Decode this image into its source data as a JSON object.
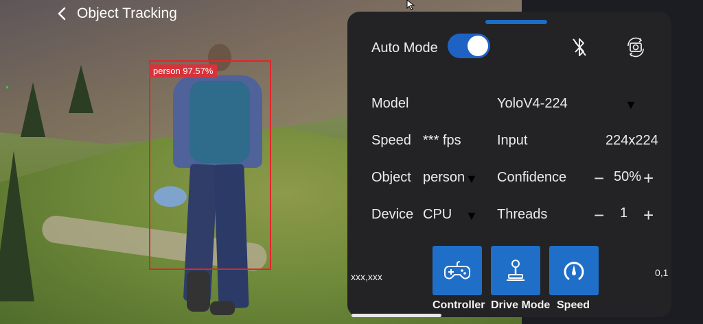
{
  "header": {
    "title": "Object Tracking"
  },
  "detection": {
    "label": "person 97.57%"
  },
  "panel": {
    "auto_mode": {
      "label": "Auto Mode",
      "enabled": true
    },
    "icons": {
      "bluetooth": "bluetooth-off-icon",
      "camera_switch": "camera-switch-icon"
    },
    "model": {
      "label": "Model",
      "value": "YoloV4-224"
    },
    "speed": {
      "label": "Speed",
      "value": "*** fps"
    },
    "input": {
      "label": "Input",
      "value": "224x224"
    },
    "object": {
      "label": "Object",
      "value": "person"
    },
    "confidence": {
      "label": "Confidence",
      "value": "50%",
      "minus": "−",
      "plus": "+"
    },
    "device": {
      "label": "Device",
      "value": "CPU"
    },
    "threads": {
      "label": "Threads",
      "value": "1",
      "minus": "−",
      "plus": "+"
    },
    "caret": "▼",
    "coords_left": "xxx,xxx",
    "coords_right": "0,1",
    "buttons": [
      {
        "label": "Controller",
        "icon": "gamepad-icon"
      },
      {
        "label": "Drive Mode",
        "icon": "joystick-icon"
      },
      {
        "label": "Speed",
        "icon": "speedometer-icon"
      }
    ]
  },
  "colors": {
    "accent": "#1f6fc9",
    "panel_bg": "#232325",
    "detection_box": "#e0262b"
  }
}
